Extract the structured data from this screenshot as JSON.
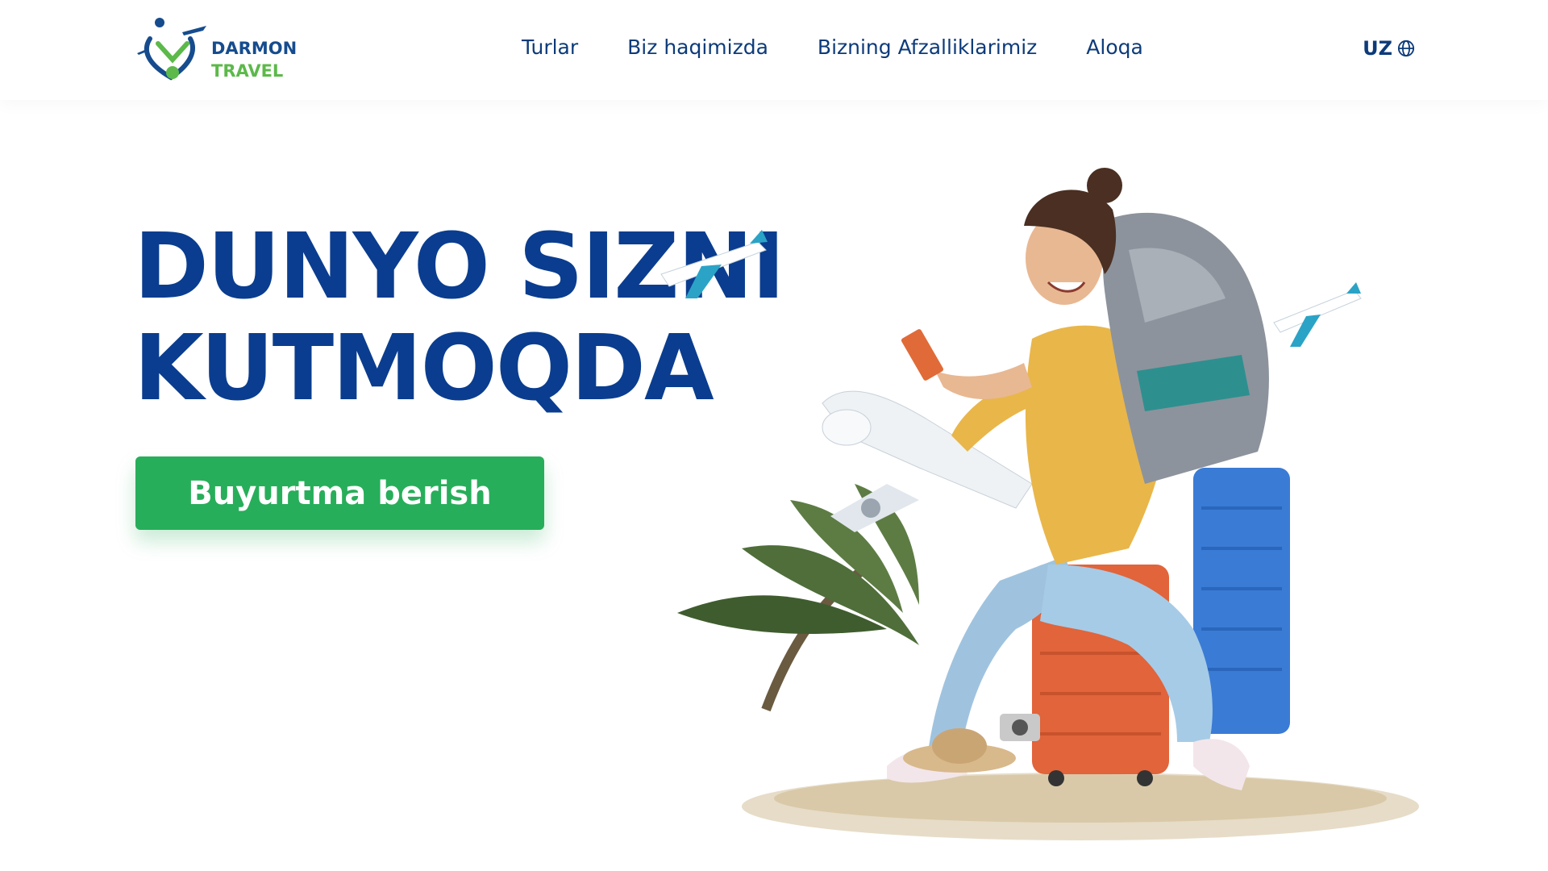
{
  "header": {
    "logo": {
      "line1": "DARMON",
      "line2": "TRAVEL",
      "icon": "darmon-travel-logo"
    },
    "nav": [
      {
        "label": "Turlar"
      },
      {
        "label": "Biz haqimizda"
      },
      {
        "label": "Bizning Afzalliklarimiz"
      },
      {
        "label": "Aloqa"
      }
    ],
    "language": {
      "label": "UZ",
      "icon": "globe-icon"
    }
  },
  "hero": {
    "title_line1": "DUNYO SIZNI",
    "title_line2": "KUTMOQDA",
    "cta_label": "Buyurtma berish"
  },
  "colors": {
    "primary_blue": "#0a3d8f",
    "nav_text": "#0d3b7a",
    "cta_green": "#27ae5a",
    "logo_green": "#5cb94a"
  }
}
